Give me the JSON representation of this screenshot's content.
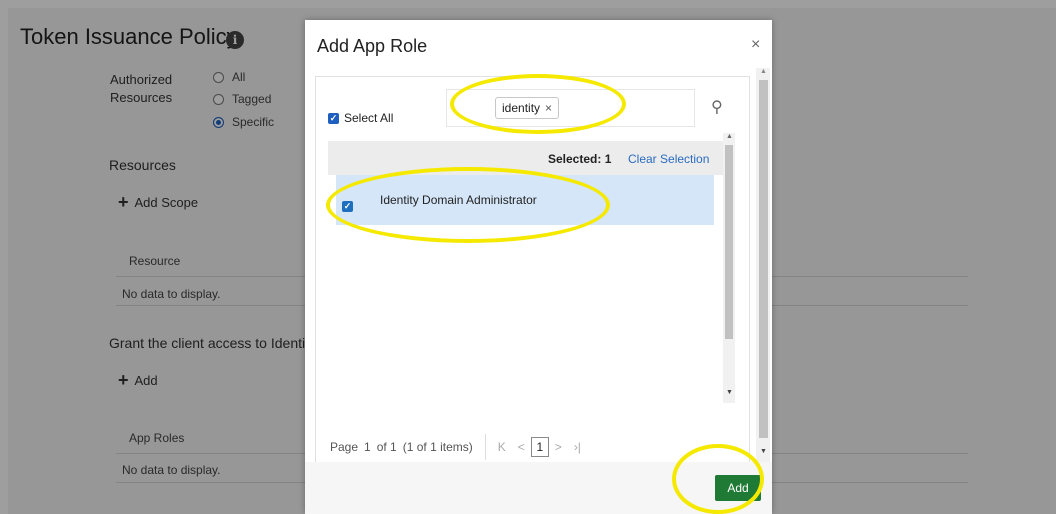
{
  "background": {
    "title": "Token Issuance Policy",
    "info_glyph": "i",
    "authorized_label_1": "Authorized",
    "authorized_label_2": "Resources",
    "radio_all": "All",
    "radio_tagged": "Tagged",
    "radio_specific": "Specific",
    "selected_radio": "Specific",
    "resources_heading": "Resources",
    "add_scope": "Add Scope",
    "resource_col": "Resource",
    "no_data_1": "No data to display.",
    "grant_text": "Grant the client access to Identity",
    "add_label": "Add",
    "app_roles_col": "App Roles",
    "no_data_2": "No data to display."
  },
  "modal": {
    "title": "Add App Role",
    "close_glyph": "×",
    "select_all": "Select All",
    "search_chip": "identity",
    "chip_remove": "×",
    "search_icon": "⚲",
    "selected_label": "Selected: 1",
    "clear_selection": "Clear Selection",
    "item_label": "Identity Domain Administrator",
    "item_checked": true,
    "pagination": {
      "page_text": "Page",
      "page_num": "1",
      "of_text": "of 1",
      "items_text": "(1 of 1 items)",
      "current_page": "1",
      "first_glyph": "K",
      "prev_glyph": "<",
      "next_glyph": ">",
      "last_glyph": "›|"
    },
    "add_button": "Add"
  },
  "colors": {
    "accent_blue": "#1f5fbf",
    "add_green": "#1e7a35",
    "highlight_yellow": "#f5e900",
    "selected_row": "#d4e6f8"
  }
}
